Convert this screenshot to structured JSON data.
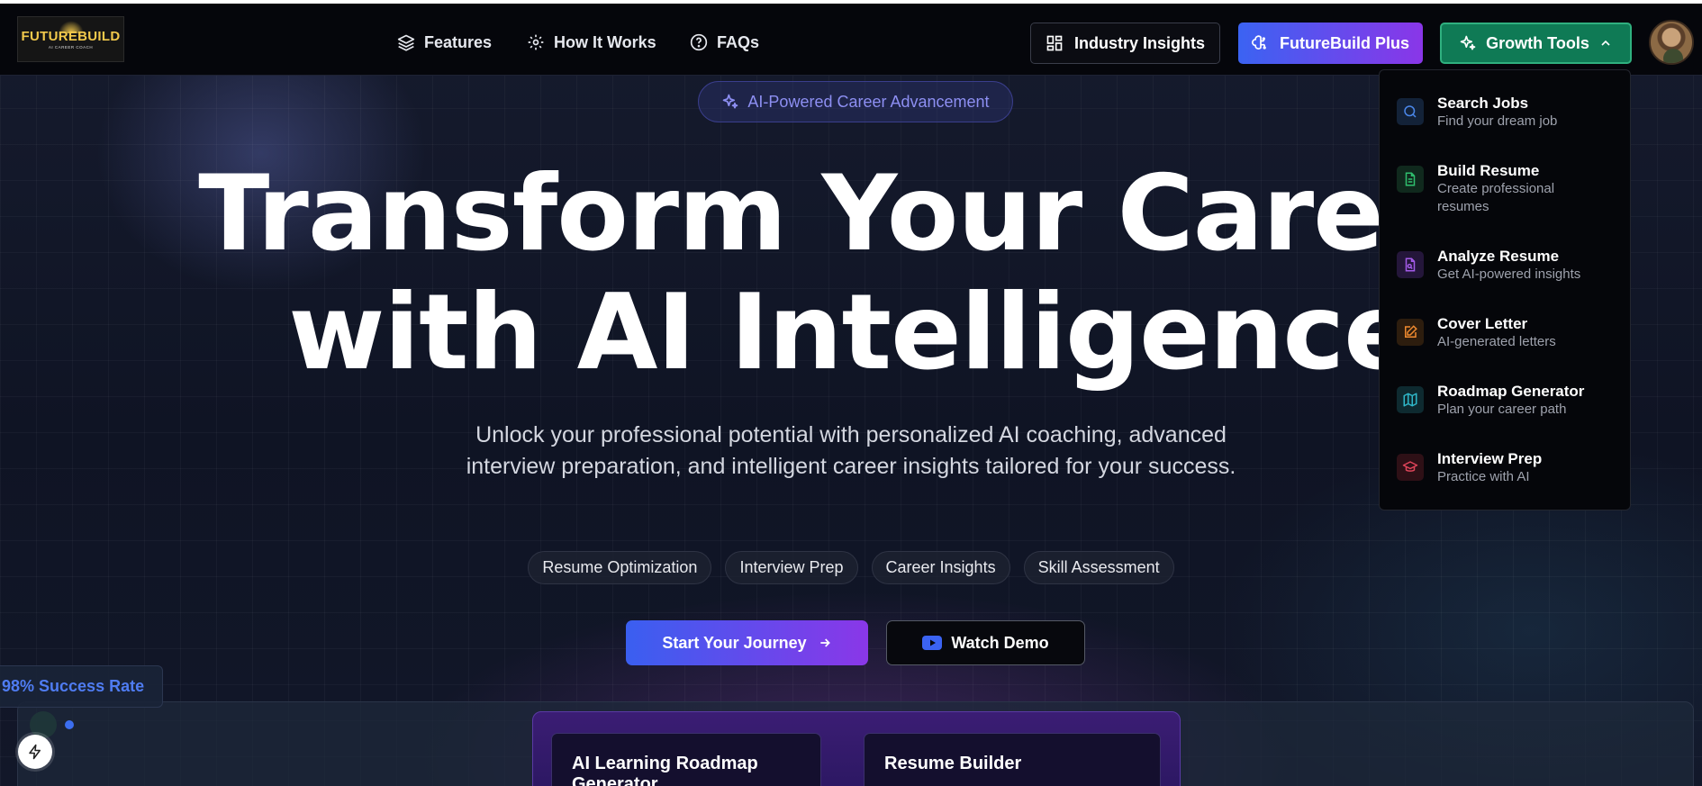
{
  "brand": {
    "logo_text": "FUTUREBUILD",
    "logo_tagline": "AI CAREER COACH"
  },
  "nav": {
    "links": [
      {
        "label": "Features",
        "icon": "layers-icon"
      },
      {
        "label": "How It Works",
        "icon": "gear-icon"
      },
      {
        "label": "FAQs",
        "icon": "help-circle-icon"
      }
    ],
    "industry_insights": "Industry Insights",
    "futurebuild_plus": "FutureBuild Plus",
    "growth_tools": "Growth Tools"
  },
  "dropdown": {
    "items": [
      {
        "title": "Search Jobs",
        "desc": "Find your dream job",
        "icon": "search-icon",
        "color": "#4a86e8"
      },
      {
        "title": "Build Resume",
        "desc": "Create professional resumes",
        "icon": "document-icon",
        "color": "#2fbf6e"
      },
      {
        "title": "Analyze Resume",
        "desc": "Get AI-powered insights",
        "icon": "file-search-icon",
        "color": "#a35be8"
      },
      {
        "title": "Cover Letter",
        "desc": "AI-generated letters",
        "icon": "pencil-square-icon",
        "color": "#ef8a2f"
      },
      {
        "title": "Roadmap Generator",
        "desc": "Plan your career path",
        "icon": "map-icon",
        "color": "#2fb7c9"
      },
      {
        "title": "Interview Prep",
        "desc": "Practice with AI",
        "icon": "graduation-cap-icon",
        "color": "#e0455a"
      }
    ]
  },
  "hero": {
    "badge": "AI-Powered Career Advancement",
    "headline_line1": "Transform Your Career",
    "headline_line2": "with AI Intelligence",
    "subtitle": "Unlock your professional potential with personalized AI coaching, advanced interview preparation, and intelligent career insights tailored for your success.",
    "chips": [
      "Resume Optimization",
      "Interview Prep",
      "Career Insights",
      "Skill Assessment"
    ],
    "cta_primary": "Start Your Journey",
    "cta_secondary": "Watch Demo"
  },
  "stats": {
    "success": "98% Success Rate"
  },
  "preview": {
    "cards": [
      "AI Learning Roadmap Generator",
      "Resume Builder"
    ]
  },
  "colors": {
    "accent_blue": "#3b63f2",
    "accent_purple": "#8a36e8",
    "growth_green": "#0f7a55"
  }
}
